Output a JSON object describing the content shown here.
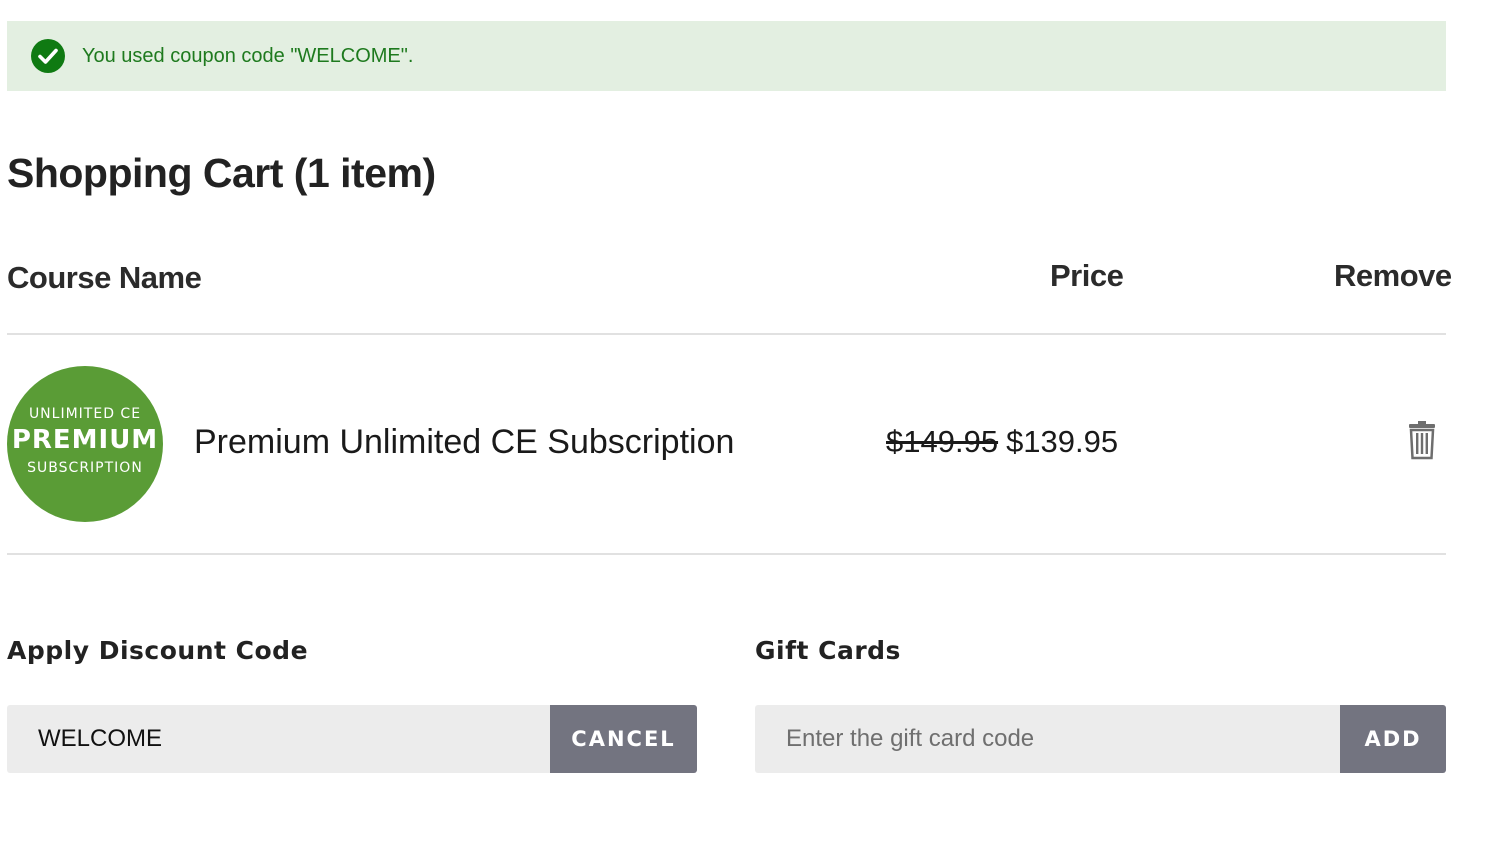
{
  "banner": {
    "message": "You used coupon code \"WELCOME\".",
    "icon": "check-circle-icon",
    "color": "#1e7a1e",
    "background": "#e3efe1"
  },
  "cart": {
    "title": "Shopping Cart (1 item)",
    "columns": {
      "course_name": "Course Name",
      "price": "Price",
      "remove": "Remove"
    },
    "items": [
      {
        "badge": {
          "line1": "UNLIMITED CE",
          "line2": "PREMIUM",
          "line3": "SUBSCRIPTION",
          "color": "#5a9c36"
        },
        "name": "Premium Unlimited CE Subscription",
        "original_price": "$149.95",
        "price": "$139.95",
        "remove_icon": "trash-icon"
      }
    ]
  },
  "discount": {
    "label": "Apply Discount Code",
    "value": "WELCOME",
    "button": "CANCEL"
  },
  "gift_cards": {
    "label": "Gift Cards",
    "placeholder": "Enter the gift card code",
    "value": "",
    "button": "ADD"
  }
}
